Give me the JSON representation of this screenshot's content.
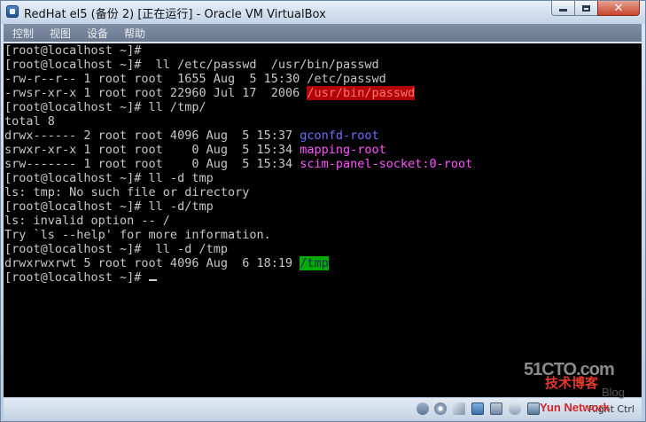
{
  "window": {
    "title": "RedHat el5 (备份 2) [正在运行] - Oracle VM VirtualBox",
    "icon": "virtualbox-app-icon",
    "controls": [
      "minimize-icon",
      "maximize-icon",
      "close-icon"
    ],
    "close_glyph": "✕"
  },
  "menubar": {
    "items": [
      "控制",
      "视图",
      "设备",
      "帮助"
    ]
  },
  "terminal": {
    "lines": [
      {
        "text": "[root@localhost ~]#"
      },
      {
        "text": "[root@localhost ~]#  ll /etc/passwd  /usr/bin/passwd"
      },
      {
        "text": "-rw-r--r-- 1 root root  1655 Aug  5 15:30 /etc/passwd"
      },
      {
        "text": "-rwsr-xr-x 1 root root 22960 Jul 17  2006 ",
        "hl": "/usr/bin/passwd",
        "style": "red-bg"
      },
      {
        "text": "[root@localhost ~]# ll /tmp/"
      },
      {
        "text": "total 8"
      },
      {
        "text": "drwx------ 2 root root 4096 Aug  5 15:37 ",
        "hl": "gconfd-root",
        "style": "blue"
      },
      {
        "text": "srwxr-xr-x 1 root root    0 Aug  5 15:34 ",
        "hl": "mapping-root",
        "style": "magenta"
      },
      {
        "text": "srw------- 1 root root    0 Aug  5 15:34 ",
        "hl": "scim-panel-socket:0-root",
        "style": "magenta"
      },
      {
        "text": "[root@localhost ~]# ll -d tmp"
      },
      {
        "text": "ls: tmp: No such file or directory"
      },
      {
        "text": "[root@localhost ~]# ll -d/tmp"
      },
      {
        "text": "ls: invalid option -- /"
      },
      {
        "text": "Try `ls --help' for more information."
      },
      {
        "text": "[root@localhost ~]#  ll -d /tmp"
      },
      {
        "text": "drwxrwxrwt 5 root root 4096 Aug  6 18:19 ",
        "hl": "/tmp",
        "style": "green-bg"
      },
      {
        "text": "[root@localhost ~]# ",
        "cursor": true
      }
    ]
  },
  "statusbar": {
    "icons": [
      "hard-disk-icon",
      "optical-drive-icon",
      "usb-icon",
      "shared-folder-icon",
      "network-icon",
      "mouse-integration-icon",
      "display-icon"
    ],
    "host_key": "Right Ctrl"
  },
  "watermark": {
    "site": "51CTO.com",
    "cn": "技术博客",
    "blog": "Blog",
    "brand": "Yun Network"
  }
}
